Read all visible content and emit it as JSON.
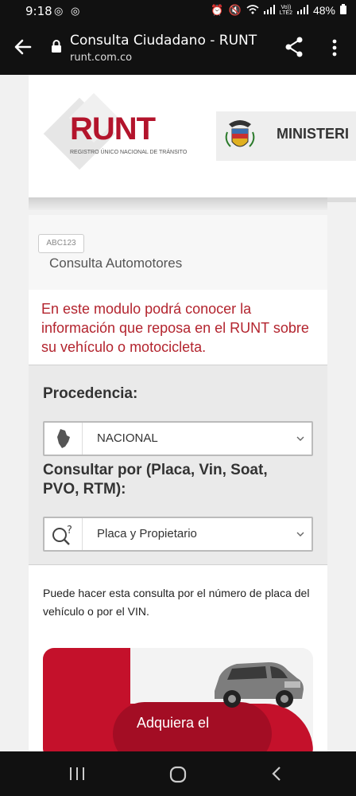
{
  "status_bar": {
    "time": "9:18",
    "left_icons": "◎ ◎",
    "lte_label": "Vo))\nLTE2",
    "battery": "48%"
  },
  "app_bar": {
    "title": "Consulta Ciudadano - RUNT",
    "url": "runt.com.co"
  },
  "header": {
    "logo_word": "RUNT",
    "logo_subtitle": "REGISTRO ÚNICO NACIONAL DE TRÁNSITO",
    "ministry_label": "MINISTERI"
  },
  "module": {
    "badge": "ABC123",
    "title": "Consulta Automotores"
  },
  "info": {
    "text": "En este modulo podrá conocer la información que reposa en el RUNT sobre su vehículo o motocicleta."
  },
  "form": {
    "procedencia_label": "Procedencia:",
    "procedencia_value": "NACIONAL",
    "consultar_label_line1": "Consultar por (Placa, Vin, Soat,",
    "consultar_label_line2": "PVO, RTM):",
    "consultar_value": "Placa y Propietario"
  },
  "help": {
    "text": "Puede hacer esta consulta por el número de placa del vehículo o por el VIN.",
    "promo_button": "Adquiera el"
  },
  "colors": {
    "brand_red": "#b3142c",
    "info_red": "#b3242e",
    "promo_red": "#c4112b"
  }
}
